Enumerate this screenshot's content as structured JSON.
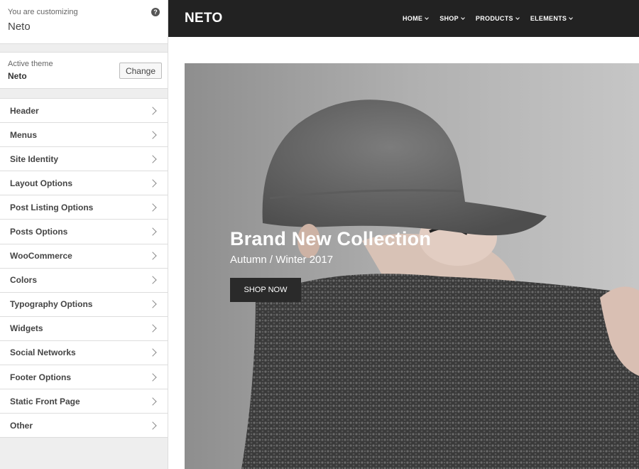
{
  "customizer": {
    "header_small": "You are customizing",
    "header_title": "Neto",
    "help_icon_glyph": "?",
    "active_theme_label": "Active theme",
    "active_theme_name": "Neto",
    "change_button": "Change",
    "sections": [
      {
        "label": "Header"
      },
      {
        "label": "Menus"
      },
      {
        "label": "Site Identity"
      },
      {
        "label": "Layout Options"
      },
      {
        "label": "Post Listing Options"
      },
      {
        "label": "Posts Options"
      },
      {
        "label": "WooCommerce"
      },
      {
        "label": "Colors"
      },
      {
        "label": "Typography Options"
      },
      {
        "label": "Widgets"
      },
      {
        "label": "Social Networks"
      },
      {
        "label": "Footer Options"
      },
      {
        "label": "Static Front Page"
      },
      {
        "label": "Other"
      }
    ]
  },
  "preview": {
    "site_title": "NETO",
    "nav": [
      {
        "label": "HOME"
      },
      {
        "label": "SHOP"
      },
      {
        "label": "PRODUCTS"
      },
      {
        "label": "ELEMENTS"
      }
    ],
    "hero": {
      "title": "Brand New Collection",
      "subtitle": "Autumn / Winter 2017",
      "button": "SHOP NOW"
    }
  },
  "colors": {
    "topbar": "#222222",
    "sidebar_bg": "#eeeeee",
    "hero_button": "#2a2a2a"
  }
}
